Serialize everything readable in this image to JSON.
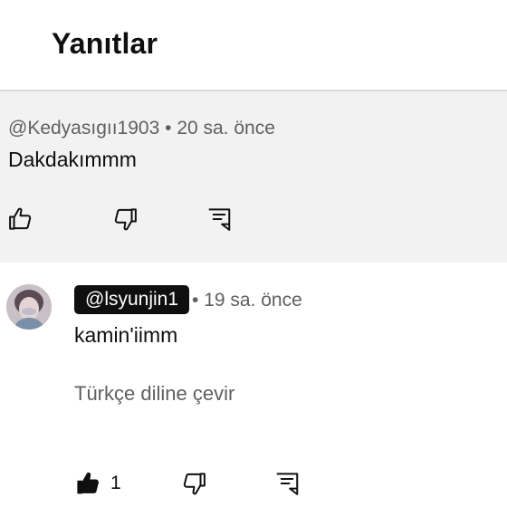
{
  "header": {
    "title": "Yanıtlar"
  },
  "parent_comment": {
    "author": "@Kedyasıgıı1903",
    "time": "20 sa. önce",
    "separator": "•",
    "text": "Dakdakımmm"
  },
  "reply": {
    "author": "@lsyunjin1",
    "time": "19 sa. önce",
    "separator": "•",
    "text": "kamin'iimm",
    "translate_label": "Türkçe diline çevir",
    "like_count": "1"
  },
  "icons": {
    "like": "thumbs-up-icon",
    "dislike": "thumbs-down-icon",
    "reply": "reply-comment-icon"
  },
  "colors": {
    "parent_background": "#f2f2f2",
    "meta_text": "#606060",
    "handle_chip": "#0f0f0f"
  }
}
